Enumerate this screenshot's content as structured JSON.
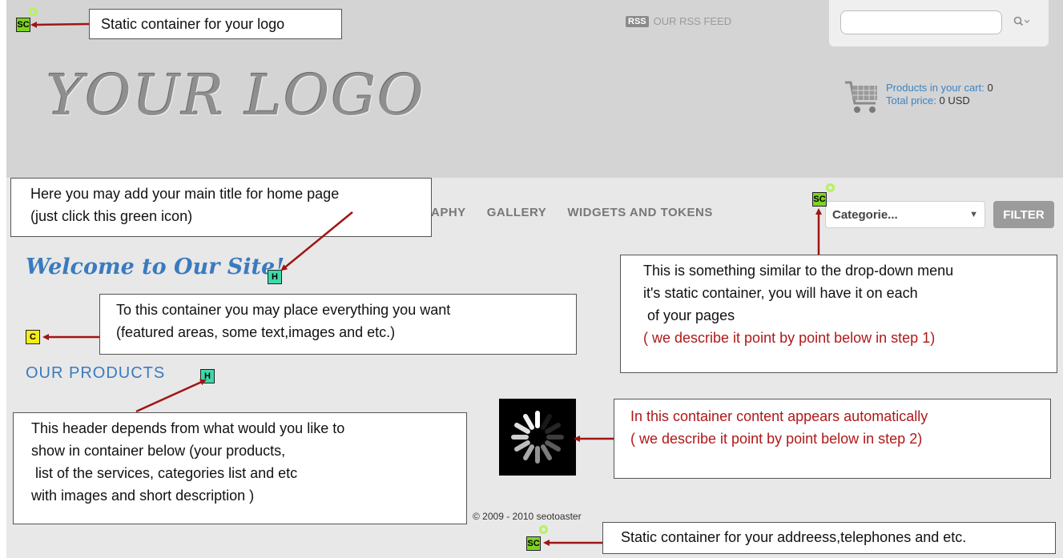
{
  "header": {
    "logo_text": "YOUR LOGO",
    "rss_icon": "RSS",
    "rss_label": "OUR RSS FEED",
    "search": {
      "value": "",
      "icon": "search-icon"
    },
    "cart": {
      "products_label": "Products in your cart:",
      "products_value": "0",
      "total_label": "Total price:",
      "total_value": "0 USD"
    }
  },
  "nav": {
    "items": [
      "APHY",
      "GALLERY",
      "WIDGETS AND TOKENS"
    ],
    "category_select": "Categorie...",
    "filter_label": "FILTER"
  },
  "main": {
    "welcome_title": "Welcome to Our Site!",
    "products_header": "OUR PRODUCTS",
    "copyright": "© 2009 - 2010 seotoaster"
  },
  "badges": {
    "sc": "SC",
    "h": "H",
    "c": "C"
  },
  "callouts": {
    "logo": "Static container for your logo",
    "title": [
      "Here you may add your main title for home page",
      "(just click this green icon)"
    ],
    "container": [
      "To this container you may place everything you want",
      "(featured areas, some text,images and etc.)"
    ],
    "dropdown": [
      "This is something similar to the drop-down menu",
      "it's static container, you will have it on each",
      " of your pages",
      "( we describe it point by point below in step 1)"
    ],
    "auto": [
      "In this container content appears automatically",
      "( we describe it point by point below in step 2)"
    ],
    "header": [
      "This header depends from what would you like to",
      "show in container below (your products,",
      " list of the services, categories list and etc",
      "with images and short description )"
    ],
    "footer": "Static container for your addreess,telephones and etc."
  },
  "colors": {
    "accent": "#3a7bbf",
    "arrow": "#a01515",
    "note_red": "#b01818"
  }
}
